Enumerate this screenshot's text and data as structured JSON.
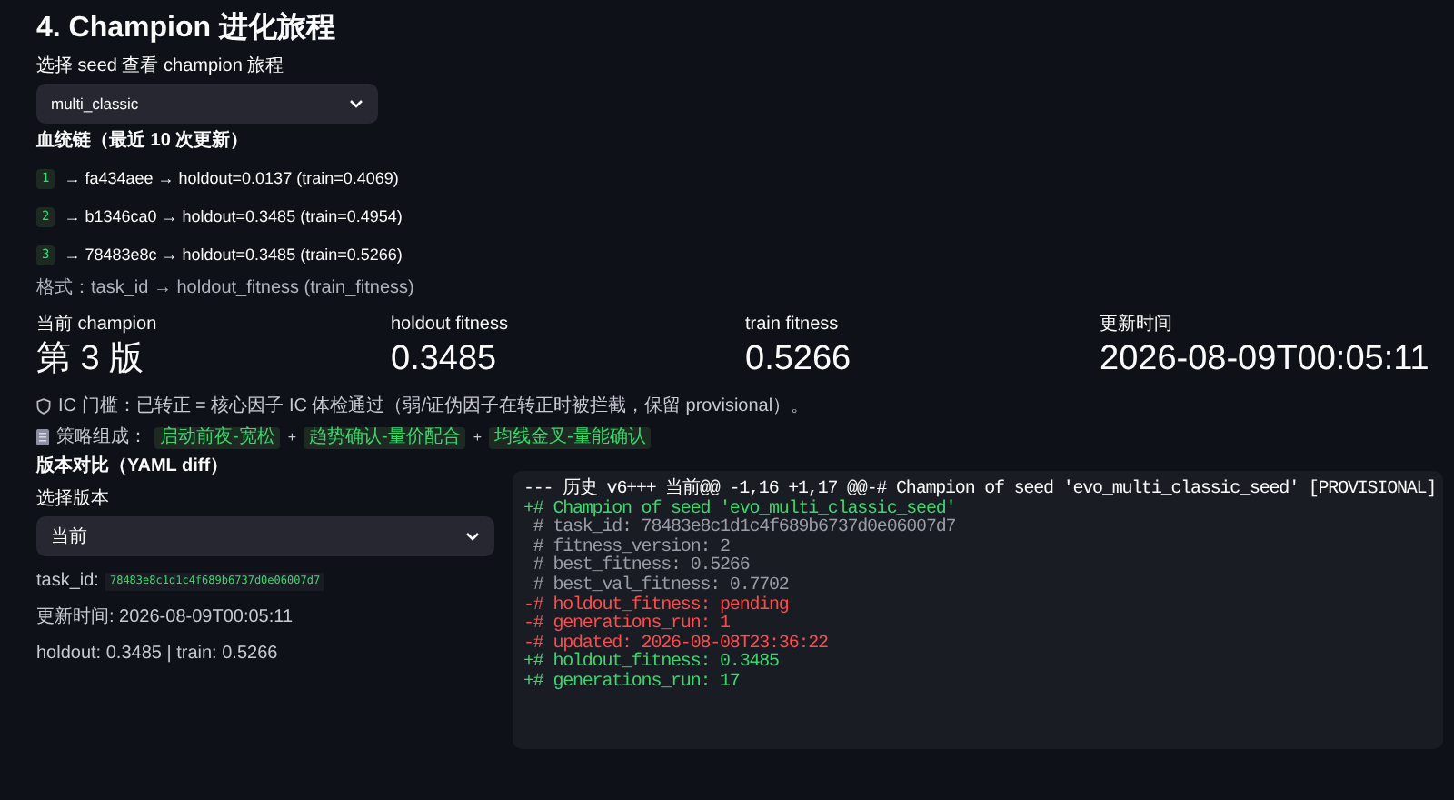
{
  "title": "4. Champion 进化旅程",
  "seed_select": {
    "label": "选择 seed 查看 champion 旅程",
    "value": "multi_classic"
  },
  "lineage": {
    "heading": "血统链（最近 10 次更新）",
    "items": [
      {
        "index": "1",
        "text": "→ fa434aee → holdout=0.0137 (train=0.4069)"
      },
      {
        "index": "2",
        "text": "→ b1346ca0 → holdout=0.3485 (train=0.4954)"
      },
      {
        "index": "3",
        "text": "→ 78483e8c → holdout=0.3485 (train=0.5266)"
      }
    ],
    "format_note": "格式：task_id → holdout_fitness (train_fitness)"
  },
  "metrics": [
    {
      "label": "当前 champion",
      "value": "第 3 版"
    },
    {
      "label": "holdout fitness",
      "value": "0.3485"
    },
    {
      "label": "train fitness",
      "value": "0.5266"
    },
    {
      "label": "更新时间",
      "value": "2026-08-09T00:05:11"
    }
  ],
  "ic_gate": "IC 门槛：已转正 = 核心因子 IC 体检通过（弱/证伪因子在转正时被拦截，保留 provisional）。",
  "strategy": {
    "label": "策略组成：",
    "separator": "+",
    "tags": [
      "启动前夜-宽松",
      "趋势确认-量价配合",
      "均线金叉-量能确认"
    ]
  },
  "version_compare": {
    "heading": "版本对比（YAML diff）",
    "select_label": "选择版本",
    "select_value": "当前",
    "task_id_label": "task_id:",
    "task_id": "78483e8c1d1c4f689b6737d0e06007d7",
    "updated": "更新时间: 2026-08-09T00:05:11",
    "scores": "holdout: 0.3485 | train: 0.5266"
  },
  "diff": [
    {
      "kind": "header",
      "text": "--- 历史 v6+++ 当前@@ -1,16 +1,17 @@-# Champion of seed 'evo_multi_classic_seed' [PROVISIONAL]"
    },
    {
      "kind": "add",
      "text": "+# Champion of seed 'evo_multi_classic_seed'"
    },
    {
      "kind": "context",
      "text": " # task_id: 78483e8c1d1c4f689b6737d0e06007d7"
    },
    {
      "kind": "context",
      "text": " # fitness_version: 2"
    },
    {
      "kind": "context",
      "text": " # best_fitness: 0.5266"
    },
    {
      "kind": "context",
      "text": " # best_val_fitness: 0.7702"
    },
    {
      "kind": "remove",
      "text": "-# holdout_fitness: pending"
    },
    {
      "kind": "remove",
      "text": "-# generations_run: 1"
    },
    {
      "kind": "remove",
      "text": "-# updated: 2026-08-08T23:36:22"
    },
    {
      "kind": "add",
      "text": "+# holdout_fitness: 0.3485"
    },
    {
      "kind": "add",
      "text": "+# generations_run: 17"
    }
  ]
}
